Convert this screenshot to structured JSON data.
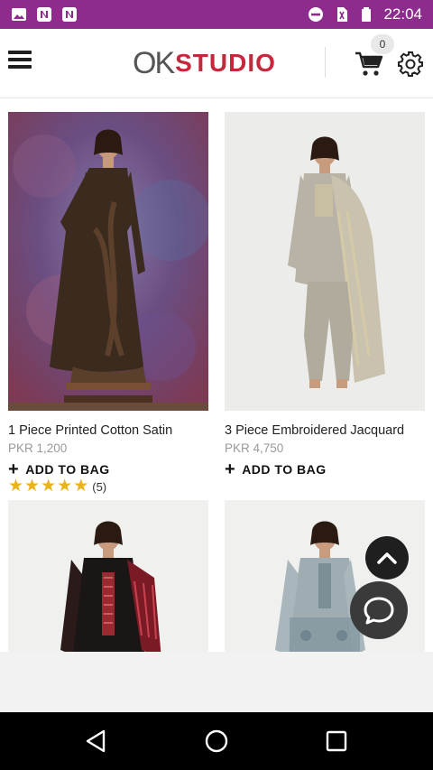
{
  "status_bar": {
    "time": "22:04",
    "left_icons": [
      "image-icon",
      "n-notification-icon",
      "n-notification-icon"
    ],
    "right_icons": [
      "do-not-disturb-icon",
      "no-sim-icon",
      "battery-icon"
    ],
    "color": "#8e2c8d"
  },
  "header": {
    "logo_prefix": "OK",
    "logo_brand": "STUDIO",
    "cart_count": "0"
  },
  "products": [
    {
      "name": "1 Piece Printed Cotton Satin",
      "price": "PKR 1,200",
      "add_label": "ADD TO BAG",
      "rating_stars": 5,
      "rating_count": "(5)"
    },
    {
      "name": "3 Piece Embroidered Jacquard",
      "price": "PKR 4,750",
      "add_label": "ADD TO BAG"
    },
    {},
    {}
  ],
  "colors": {
    "brand_red": "#c5283d",
    "star": "#e8b419"
  }
}
